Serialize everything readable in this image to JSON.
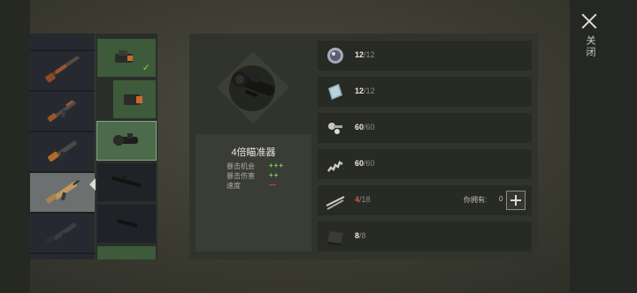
{
  "header": {
    "close_label": "关闭"
  },
  "weapons": [
    {
      "name": "shotgun-icon",
      "selected": false
    },
    {
      "name": "ak-rifle-icon",
      "selected": false
    },
    {
      "name": "smg-icon",
      "selected": false
    },
    {
      "name": "scar-rifle-icon",
      "selected": true
    },
    {
      "name": "m4-rifle-icon",
      "selected": false
    }
  ],
  "scopes": [
    {
      "name": "red-dot-scope-icon",
      "state": "owned-equipped"
    },
    {
      "name": "holo-scope-icon",
      "state": "owned"
    },
    {
      "name": "4x-scope-icon",
      "state": "selected"
    },
    {
      "name": "long-scope-icon",
      "state": "locked"
    },
    {
      "name": "short-scope-icon",
      "state": "locked"
    }
  ],
  "item_info": {
    "title": "4倍瞄准器",
    "stats": [
      {
        "label": "暴击机会",
        "value": "+++",
        "polarity": "positive"
      },
      {
        "label": "暴击伤害",
        "value": "++",
        "polarity": "positive"
      },
      {
        "label": "速度",
        "value": "—",
        "polarity": "negative"
      }
    ]
  },
  "materials": [
    {
      "icon": "lens-icon",
      "have": "12",
      "need": "/12",
      "sufficient": true
    },
    {
      "icon": "glass-plate-icon",
      "have": "12",
      "need": "/12",
      "sufficient": true
    },
    {
      "icon": "screws-icon",
      "have": "60",
      "need": "/60",
      "sufficient": true
    },
    {
      "icon": "spring-icon",
      "have": "60",
      "need": "/60",
      "sufficient": true
    },
    {
      "icon": "metal-rods-icon",
      "have": "4",
      "need": "/18",
      "sufficient": false,
      "owned_label": "你拥有:",
      "owned_count": "0"
    },
    {
      "icon": "metal-sheet-icon",
      "have": "8",
      "need": "/8",
      "sufficient": true
    }
  ],
  "colors": {
    "positive": "#7bd35b",
    "negative": "#e04a3b",
    "accent": "#4b6b4a"
  }
}
